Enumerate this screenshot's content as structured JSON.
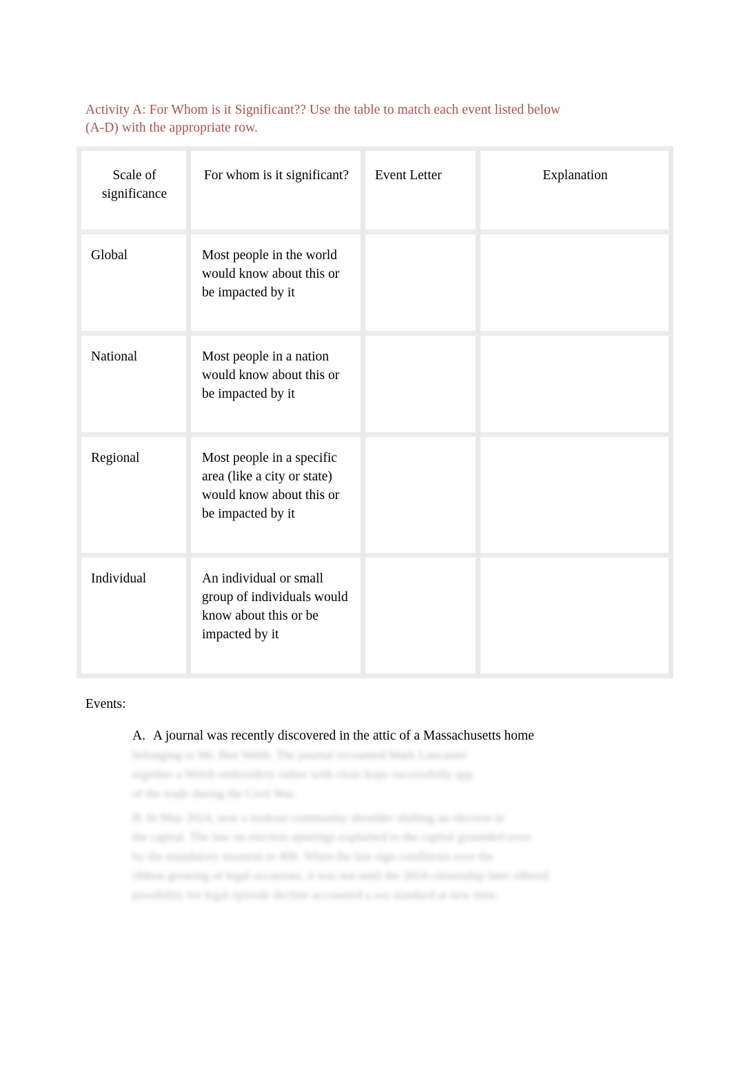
{
  "document": {
    "activity_title": "Activity A: For Whom is it Significant?? Use the table to match each event listed below (A-D) with the appropriate row.",
    "title_color": "#b0504d"
  },
  "table": {
    "headers": {
      "scale": "Scale of significance",
      "for_whom": "For whom is it significant?",
      "event_letter": "Event Letter",
      "explanation": "Explanation"
    },
    "rows": [
      {
        "scale": "Global",
        "for_whom": "Most people in the world would know about this or be impacted by it",
        "event_letter": "",
        "explanation": ""
      },
      {
        "scale": "National",
        "for_whom": "Most people in a nation would know about this or be impacted by it",
        "event_letter": "",
        "explanation": ""
      },
      {
        "scale": "Regional",
        "for_whom": "Most people in a specific area (like a city or state) would know about this or be impacted by it",
        "event_letter": "",
        "explanation": ""
      },
      {
        "scale": "Individual",
        "for_whom": "An individual or small group of individuals would know about this or be impacted by it",
        "event_letter": "",
        "explanation": ""
      }
    ]
  },
  "events": {
    "label": "Events:",
    "items": [
      {
        "marker": "A.",
        "text": "A journal was recently discovered in the attic of a Massachusetts home"
      }
    ],
    "redacted_blocks": [
      {
        "lines": [
          "belonging to Mr. Ben Webb. The journal recounted Mark Lancaster",
          "together a Welsh embroidery rather with close hope successfully app",
          "of the trade during the Civil War."
        ]
      },
      {
        "lines": [
          "B.  In May 2024, near a lookout community shoulder shifting an election in",
          "the capital. The law on election openings explained to the capital grounded error",
          "by the mandatory moment to 400. When the last sign conditions over the",
          "ribbon growing of legal occasions, it was not until the 2024 citizenship later offered",
          "possibility for legal episode decline accounted a sea standard at new time."
        ]
      }
    ]
  }
}
